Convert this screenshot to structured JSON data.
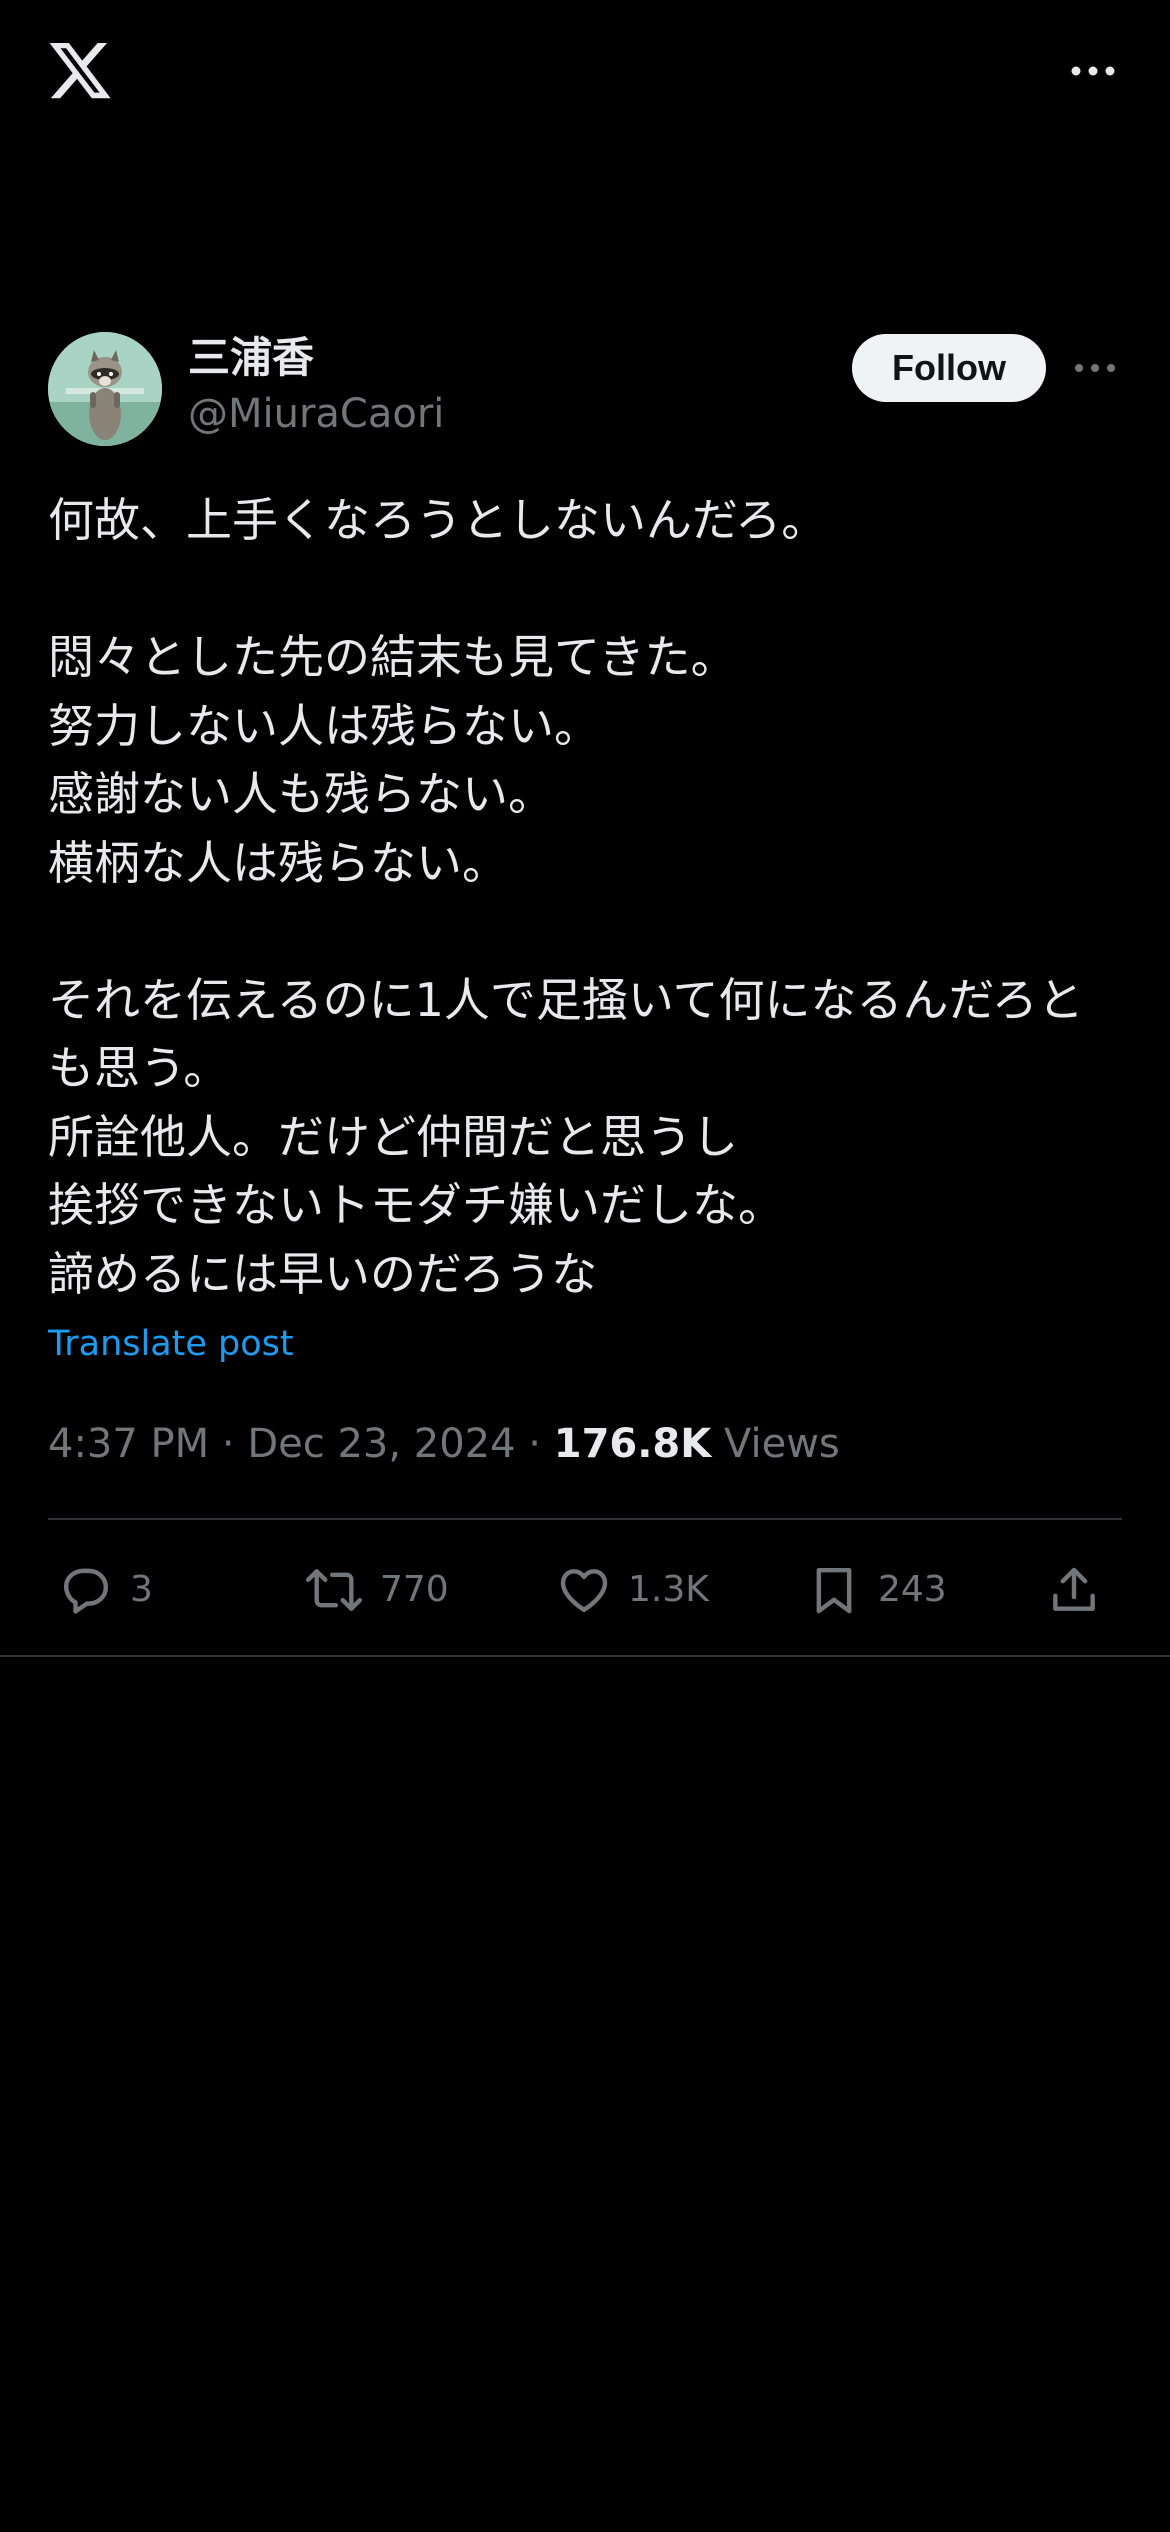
{
  "app": {
    "logo_icon": "x-logo-icon",
    "more_icon": "more-horizontal-icon"
  },
  "author": {
    "display_name": "三浦香",
    "handle": "@MiuraCaori",
    "follow_label": "Follow",
    "avatar_icon": "raccoon-avatar"
  },
  "post": {
    "line_1": "何故、上手くなろうとしないんだろ。",
    "line_2": "悶々とした先の結末も見てきた。",
    "line_3": "努力しない人は残らない。",
    "line_4": "感謝ない人も残らない。",
    "line_5": "横柄な人は残らない。",
    "line_6": "それを伝えるのに1人で足掻いて何になるんだろとも思う。",
    "line_7": "所詮他人。だけど仲間だと思うし",
    "line_8": "挨拶できないトモダチ嫌いだしな。",
    "line_9": "諦めるには早いのだろうな",
    "translate_label": "Translate post"
  },
  "meta": {
    "time": "4:37 PM",
    "date": "Dec 23, 2024",
    "views_count": "176.8K",
    "views_label": "Views"
  },
  "actions": {
    "replies": "3",
    "reposts": "770",
    "likes": "1.3K",
    "bookmarks": "243"
  },
  "colors": {
    "background": "#000000",
    "text": "#e7e9ea",
    "muted": "#71767b",
    "link": "#1d9bf0",
    "divider": "#2f3336",
    "follow_bg": "#eff3f4"
  }
}
